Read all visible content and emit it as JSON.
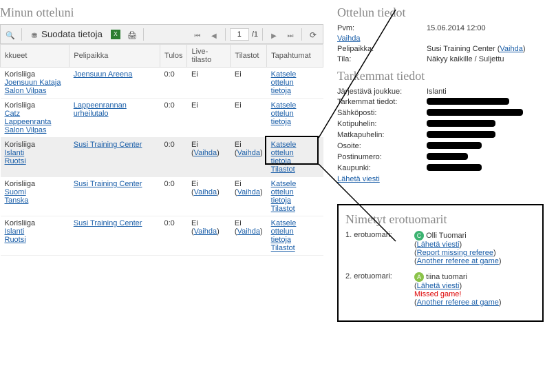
{
  "left": {
    "title": "Minun otteluni",
    "toolbar": {
      "filter_label": "Suodata tietoja",
      "page_value": "1",
      "page_total": "/1"
    },
    "headers": {
      "teams": "kkueet",
      "venue": "Pelipaikka",
      "score": "Tulos",
      "live": "Live-tilasto",
      "stats": "Tilastot",
      "events": "Tapahtumat"
    },
    "rows": [
      {
        "league": "Korisliiga",
        "team1": "Joensuun Kataja",
        "team2": "Salon Vilpas",
        "venue": "Joensuun Areena",
        "score": "0:0",
        "live": "Ei",
        "live_link": "",
        "stats": "Ei",
        "stats_link": "",
        "event1": "Katsele ottelun",
        "event2": "tietoja",
        "event3": ""
      },
      {
        "league": "Korisliiga",
        "team1": "Catz Lappeenranta",
        "team2": "Salon Vilpas",
        "venue": "Lappeenrannan urheilutalo",
        "score": "0:0",
        "live": "Ei",
        "live_link": "",
        "stats": "Ei",
        "stats_link": "",
        "event1": "Katsele ottelun",
        "event2": "tietoja",
        "event3": ""
      },
      {
        "league": "Korisliiga",
        "team1": "Islanti",
        "team2": "Ruotsi",
        "venue": "Susi Training Center",
        "score": "0:0",
        "live": "Ei",
        "live_link": "Vaihda",
        "stats": "Ei",
        "stats_link": "Vaihda",
        "event1": "Katsele ottelun",
        "event2": "tietoja",
        "event3": "Tilastot"
      },
      {
        "league": "Korisliiga",
        "team1": "Suomi",
        "team2": "Tanska",
        "venue": "Susi Training Center",
        "score": "0:0",
        "live": "Ei",
        "live_link": "Vaihda",
        "stats": "Ei",
        "stats_link": "Vaihda",
        "event1": "Katsele ottelun",
        "event2": "tietoja",
        "event3": "Tilastot"
      },
      {
        "league": "Korisliiga",
        "team1": "Islanti",
        "team2": "Ruotsi",
        "venue": "Susi Training Center",
        "score": "0:0",
        "live": "Ei",
        "live_link": "Vaihda",
        "stats": "Ei",
        "stats_link": "Vaihda",
        "event1": "Katsele ottelun",
        "event2": "tietoja",
        "event3": "Tilastot"
      }
    ]
  },
  "right": {
    "title": "Ottelun tiedot",
    "pvm_label": "Pvm:",
    "pvm_value": "15.06.2014 12:00",
    "vaihda": "Vaihda",
    "venue_label": "Pelipaikka:",
    "venue_value": "Susi Training Center",
    "status_label": "Tila:",
    "status_value": "Näkyy kaikille / Suljettu",
    "details_title": "Tarkemmat tiedot",
    "organizer_label": "Järjestävä joukkue:",
    "organizer_value": "Islanti",
    "moreinfo_label": "Tarkemmat tiedot:",
    "email_label": "Sähköposti:",
    "homephone_label": "Kotipuhelin:",
    "mobile_label": "Matkapuhelin:",
    "address_label": "Osoite:",
    "postcode_label": "Postinumero:",
    "city_label": "Kaupunki:",
    "send_msg": "Lähetä viesti"
  },
  "refs": {
    "title": "Nimetyt erotuomarit",
    "r1_label": "1. erotuomari:",
    "r1_badge": "C",
    "r1_name": "Olli Tuomari",
    "r1_send": "Lähetä viesti",
    "r1_report": "Report missing referee",
    "r1_another": "Another referee at game",
    "r2_label": "2. erotuomari:",
    "r2_badge": "A",
    "r2_name": "tiina tuomari",
    "r2_send": "Lähetä viesti",
    "r2_missed": "Missed game!",
    "r2_another": "Another referee at game"
  }
}
